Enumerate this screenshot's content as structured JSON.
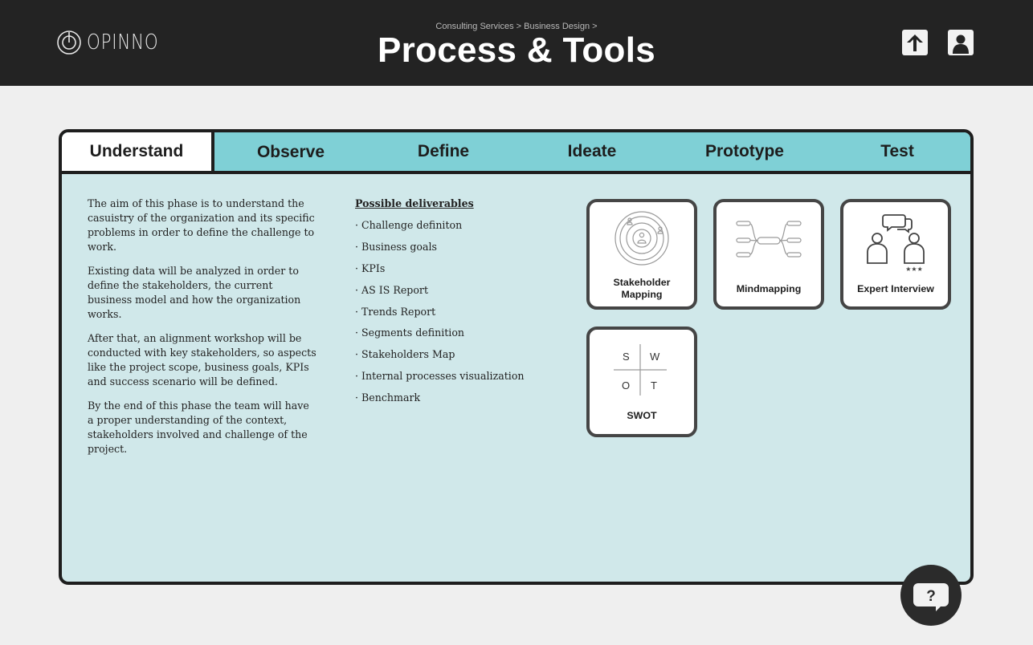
{
  "header": {
    "logo_text": "OPINNO",
    "breadcrumb": "Consulting Services > Business Design >",
    "title": "Process & Tools",
    "upload_icon": "arrow-up-icon",
    "profile_icon": "user-icon"
  },
  "tabs": [
    {
      "label": "Understand",
      "active": true
    },
    {
      "label": "Observe",
      "active": false
    },
    {
      "label": "Define",
      "active": false
    },
    {
      "label": "Ideate",
      "active": false
    },
    {
      "label": "Prototype",
      "active": false
    },
    {
      "label": "Test",
      "active": false
    }
  ],
  "description": [
    "The aim of this phase is to understand the casuistry of the organization and its specific problems in order to define the challenge to work.",
    "Existing data will be analyzed in order to define the stakeholders, the current business model and how the organization works.",
    "After that, an alignment workshop will be conducted with key stakeholders, so aspects like the project scope, business goals, KPIs and success scenario will be defined.",
    "By the end of this phase the team will have a proper understanding of the context, stakeholders involved and challenge of the project."
  ],
  "deliverables": {
    "title": "Possible deliverables",
    "items": [
      "Challenge definiton",
      "Business goals",
      "KPIs",
      "AS IS Report",
      "Trends Report",
      "Segments definition",
      "Stakeholders Map",
      "Internal processes visualization",
      "Benchmark"
    ]
  },
  "tools": [
    {
      "label": "Stakeholder Mapping",
      "icon": "target-people-icon"
    },
    {
      "label": "Mindmapping",
      "icon": "mindmap-icon"
    },
    {
      "label": "Expert Interview",
      "icon": "interview-icon"
    },
    {
      "label": "SWOT",
      "icon": "swot-grid-icon",
      "quadrants": [
        "S",
        "W",
        "O",
        "T"
      ]
    }
  ],
  "help": {
    "label": "?",
    "icon": "chat-bubble-question-icon"
  },
  "colors": {
    "topbar": "#232323",
    "tabbar": "#7fd0d6",
    "panel": "#d0e8ea",
    "card_border": "#454545"
  }
}
